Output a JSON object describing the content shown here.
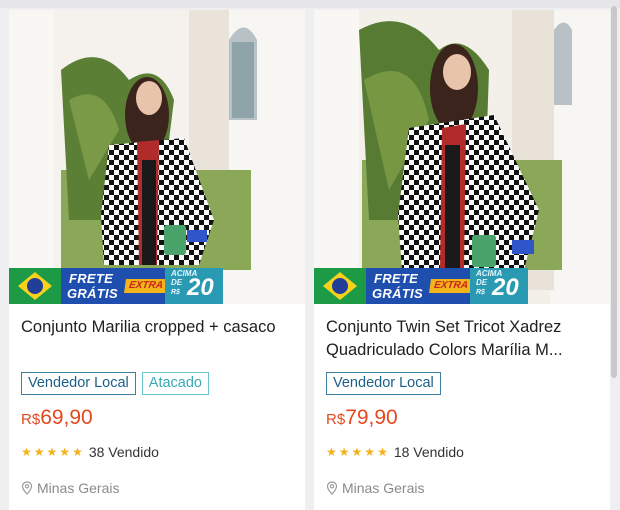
{
  "colors": {
    "page_bg": "#efeff1",
    "price": "#e2491e",
    "tag_local": "#1b5f86",
    "tag_atacado": "#3aaab8",
    "star": "#f3b21a"
  },
  "banner": {
    "line1": "FRETE",
    "line2": "GRÁTIS",
    "extra": "EXTRA",
    "acima": "ACIMA",
    "de": "DE",
    "currency": "R$",
    "amount": "20"
  },
  "products": [
    {
      "title": "Conjunto Marilia cropped + casaco",
      "tags": [
        "Vendedor Local",
        "Atacado"
      ],
      "price_currency": "R$",
      "price_value": "69,90",
      "rating_stars": 5,
      "sold": "38 Vendido",
      "location": "Minas Gerais",
      "icons": {
        "location": "location-pin-icon",
        "star": "star-icon"
      }
    },
    {
      "title": "Conjunto Twin Set Tricot Xadrez Quadriculado Colors Marília M...",
      "tags": [
        "Vendedor Local"
      ],
      "price_currency": "R$",
      "price_value": "79,90",
      "rating_stars": 5,
      "sold": "18 Vendido",
      "location": "Minas Gerais",
      "icons": {
        "location": "location-pin-icon",
        "star": "star-icon"
      }
    }
  ]
}
